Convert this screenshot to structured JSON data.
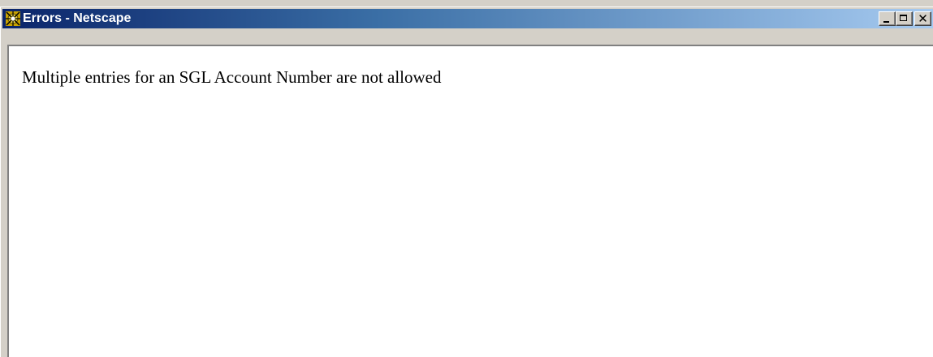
{
  "window": {
    "title": "Errors - Netscape",
    "icon": "netscape-icon",
    "controls": {
      "minimize_icon": "minimize-icon",
      "maximize_icon": "maximize-icon",
      "close_label": "✕"
    }
  },
  "content": {
    "message": "Multiple entries for an SGL Account Number are not allowed"
  },
  "colors": {
    "titlebar_start": "#0a246a",
    "titlebar_end": "#a6caf0",
    "chrome": "#d4d0c8",
    "content_bg": "#ffffff"
  }
}
